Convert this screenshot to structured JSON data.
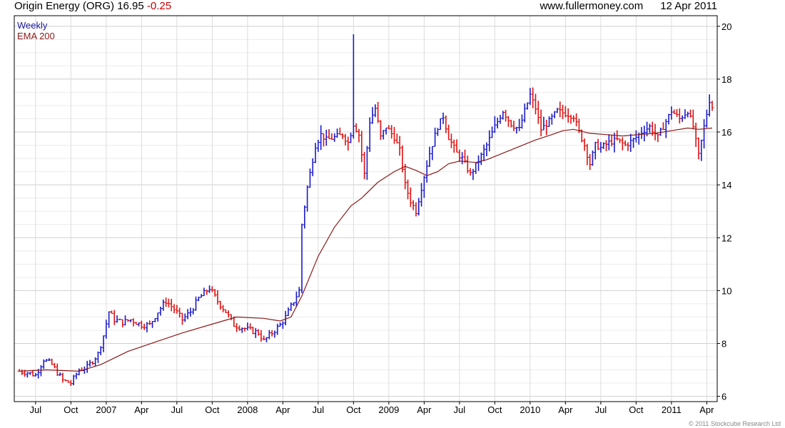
{
  "header": {
    "title": "Origin Energy (ORG) 16.95",
    "change": "-0.25",
    "site": "www.fullermoney.com",
    "date": "12 Apr 2011"
  },
  "legend": {
    "series1": "Weekly",
    "series2": "EMA 200"
  },
  "copyright": "© 2011 Stockcube Research Ltd",
  "colors": {
    "up": "#1a1acc",
    "down": "#e01010",
    "ema": "#8b1a1a",
    "grid": "#dcdcdc"
  },
  "chart_data": {
    "type": "line",
    "title": "Origin Energy (ORG) 16.95 -0.25",
    "xlabel": "",
    "ylabel": "",
    "ylim": [
      5.8,
      20.4
    ],
    "grid": true,
    "y_ticks": [
      6,
      8,
      10,
      12,
      14,
      16,
      18,
      20
    ],
    "x_ticks": [
      {
        "label": "Jul",
        "week": 6
      },
      {
        "label": "Oct",
        "week": 19
      },
      {
        "label": "2007",
        "week": 32
      },
      {
        "label": "Apr",
        "week": 45
      },
      {
        "label": "Jul",
        "week": 58
      },
      {
        "label": "Oct",
        "week": 71
      },
      {
        "label": "2008",
        "week": 84
      },
      {
        "label": "Apr",
        "week": 97
      },
      {
        "label": "Jul",
        "week": 110
      },
      {
        "label": "Oct",
        "week": 123
      },
      {
        "label": "2009",
        "week": 136
      },
      {
        "label": "Apr",
        "week": 149
      },
      {
        "label": "Jul",
        "week": 162
      },
      {
        "label": "Oct",
        "week": 175
      },
      {
        "label": "2010",
        "week": 188
      },
      {
        "label": "Apr",
        "week": 201
      },
      {
        "label": "Jul",
        "week": 214
      },
      {
        "label": "Oct",
        "week": 227
      },
      {
        "label": "2011",
        "week": 240
      },
      {
        "label": "Apr",
        "week": 253
      }
    ],
    "series": [
      {
        "name": "Weekly",
        "close_points": [
          [
            0,
            6.95
          ],
          [
            3,
            6.9
          ],
          [
            6,
            6.8
          ],
          [
            9,
            7.4
          ],
          [
            12,
            7.2
          ],
          [
            16,
            6.6
          ],
          [
            19,
            6.5
          ],
          [
            22,
            7.0
          ],
          [
            25,
            7.1
          ],
          [
            29,
            7.6
          ],
          [
            31,
            8.3
          ],
          [
            33,
            9.2
          ],
          [
            35,
            8.9
          ],
          [
            38,
            8.8
          ],
          [
            41,
            8.9
          ],
          [
            45,
            8.7
          ],
          [
            48,
            8.7
          ],
          [
            51,
            9.2
          ],
          [
            54,
            9.6
          ],
          [
            57,
            9.3
          ],
          [
            60,
            8.9
          ],
          [
            63,
            9.2
          ],
          [
            66,
            9.7
          ],
          [
            70,
            10.1
          ],
          [
            73,
            9.6
          ],
          [
            76,
            9.2
          ],
          [
            79,
            8.7
          ],
          [
            82,
            8.6
          ],
          [
            85,
            8.5
          ],
          [
            88,
            8.4
          ],
          [
            90,
            8.1
          ],
          [
            93,
            8.4
          ],
          [
            96,
            8.7
          ],
          [
            98,
            9.0
          ],
          [
            101,
            9.6
          ],
          [
            103,
            10.0
          ],
          [
            104,
            12.5
          ],
          [
            106,
            13.9
          ],
          [
            109,
            15.5
          ],
          [
            111,
            15.9
          ],
          [
            113,
            15.7
          ],
          [
            116,
            15.8
          ],
          [
            119,
            15.9
          ],
          [
            121,
            15.6
          ],
          [
            123,
            16.3
          ],
          [
            125,
            15.9
          ],
          [
            127,
            14.4
          ],
          [
            129,
            16.4
          ],
          [
            131,
            16.9
          ],
          [
            133,
            15.8
          ],
          [
            135,
            16.2
          ],
          [
            138,
            15.8
          ],
          [
            140,
            15.3
          ],
          [
            142,
            14.0
          ],
          [
            144,
            13.4
          ],
          [
            146,
            13.0
          ],
          [
            148,
            13.9
          ],
          [
            151,
            15.2
          ],
          [
            154,
            16.2
          ],
          [
            156,
            16.6
          ],
          [
            158,
            15.8
          ],
          [
            161,
            15.2
          ],
          [
            163,
            15.0
          ],
          [
            166,
            14.4
          ],
          [
            169,
            14.9
          ],
          [
            172,
            15.5
          ],
          [
            175,
            16.2
          ],
          [
            178,
            16.8
          ],
          [
            181,
            16.3
          ],
          [
            184,
            16.1
          ],
          [
            186,
            16.8
          ],
          [
            188,
            17.4
          ],
          [
            190,
            16.9
          ],
          [
            192,
            16.1
          ],
          [
            195,
            16.4
          ],
          [
            198,
            16.8
          ],
          [
            201,
            16.7
          ],
          [
            204,
            16.6
          ],
          [
            206,
            16.0
          ],
          [
            208,
            15.5
          ],
          [
            210,
            14.8
          ],
          [
            212,
            15.5
          ],
          [
            214,
            15.4
          ],
          [
            217,
            15.6
          ],
          [
            220,
            15.7
          ],
          [
            223,
            15.5
          ],
          [
            226,
            15.7
          ],
          [
            229,
            16.0
          ],
          [
            232,
            16.2
          ],
          [
            235,
            15.8
          ],
          [
            238,
            16.4
          ],
          [
            240,
            16.8
          ],
          [
            243,
            16.5
          ],
          [
            246,
            16.8
          ],
          [
            248,
            16.2
          ],
          [
            250,
            15.1
          ],
          [
            252,
            16.2
          ],
          [
            254,
            17.2
          ],
          [
            255,
            16.95
          ]
        ]
      },
      {
        "name": "EMA 200",
        "points": [
          [
            0,
            6.95
          ],
          [
            10,
            7.0
          ],
          [
            22,
            6.95
          ],
          [
            30,
            7.2
          ],
          [
            40,
            7.7
          ],
          [
            50,
            8.05
          ],
          [
            60,
            8.4
          ],
          [
            70,
            8.7
          ],
          [
            80,
            9.0
          ],
          [
            90,
            8.95
          ],
          [
            96,
            8.85
          ],
          [
            100,
            9.0
          ],
          [
            104,
            9.8
          ],
          [
            110,
            11.3
          ],
          [
            116,
            12.4
          ],
          [
            122,
            13.2
          ],
          [
            126,
            13.5
          ],
          [
            132,
            14.1
          ],
          [
            138,
            14.5
          ],
          [
            142,
            14.7
          ],
          [
            146,
            14.55
          ],
          [
            150,
            14.35
          ],
          [
            154,
            14.5
          ],
          [
            158,
            14.8
          ],
          [
            162,
            14.9
          ],
          [
            168,
            14.85
          ],
          [
            172,
            14.95
          ],
          [
            178,
            15.2
          ],
          [
            184,
            15.45
          ],
          [
            190,
            15.7
          ],
          [
            196,
            15.9
          ],
          [
            200,
            16.05
          ],
          [
            204,
            16.1
          ],
          [
            210,
            15.95
          ],
          [
            216,
            15.9
          ],
          [
            222,
            15.85
          ],
          [
            228,
            15.9
          ],
          [
            234,
            15.95
          ],
          [
            240,
            16.05
          ],
          [
            246,
            16.15
          ],
          [
            250,
            16.1
          ],
          [
            255,
            16.15
          ]
        ]
      }
    ]
  }
}
